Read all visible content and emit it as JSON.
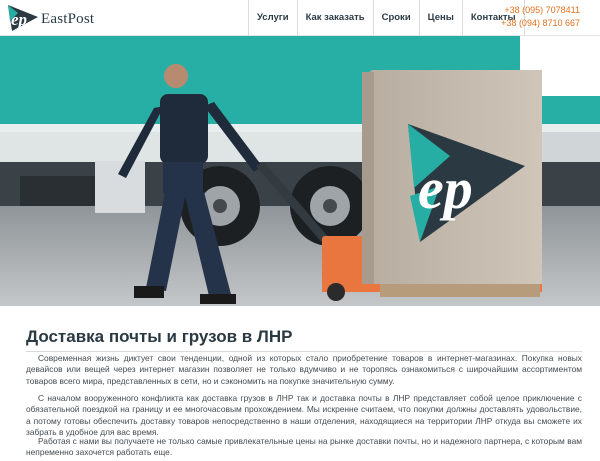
{
  "header": {
    "logo_text": "EastPost",
    "logo_mark": "ep",
    "nav": [
      {
        "label": "Услуги"
      },
      {
        "label": "Как заказать"
      },
      {
        "label": "Сроки"
      },
      {
        "label": "Цены"
      },
      {
        "label": "Контакты"
      }
    ],
    "phones": [
      "+38 (095) 7078411",
      "+38 (094) 8710 667"
    ]
  },
  "hero": {
    "box_logo": "ep"
  },
  "main": {
    "title": "Доставка почты и грузов в ЛНР",
    "paragraphs": [
      "Современная жизнь диктует свои тенденции, одной из которых стало приобретение товаров в интернет-магазинах. Покупка новых девайсов или вещей через интернет магазин позволяет не только вдумчиво и не торопясь ознакомиться с широчайшим ассортиментом товаров всего мира, представленных в сети, но и сэкономить на покупке значительную сумму.",
      "С началом вооруженного конфликта как доставка грузов в ЛНР так и доставка почты в ЛНР представляет собой целое приключение с обязательной поездкой на границу и ее многочасовым прохождением. Мы искренне считаем, что покупки должны доставлять удовольствие, а потому готовы обеспечить доставку товаров непосредственно в наши отделения, находящиеся на территории ЛНР откуда вы сможете их забрать в удобное для вас время.",
      "Работая с нами вы получаете не только самые привлекательные цены на рынке доставки почты, но и надежного партнера, с которым вам непременно захочется работать еще."
    ]
  },
  "colors": {
    "accent_orange": "#e0701e",
    "teal": "#27aea4",
    "dark_text": "#2a3942"
  },
  "icons": [
    "ep-logo-icon"
  ]
}
